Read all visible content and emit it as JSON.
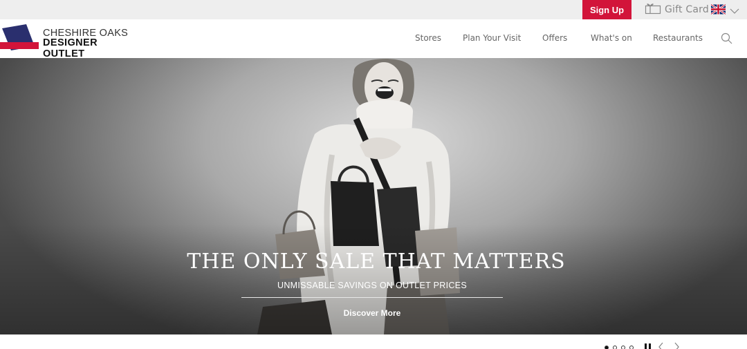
{
  "utility": {
    "signup_label": "Sign Up",
    "giftcard_label": "Gift Card",
    "signup_color": "#d2143a"
  },
  "header": {
    "logo_line1": "CHESHIRE OAKS",
    "logo_line2": "DESIGNER OUTLET",
    "nav": [
      "Stores",
      "Plan Your Visit",
      "Offers",
      "What's on",
      "Restaurants"
    ]
  },
  "hero": {
    "headline": "THE ONLY SALE THAT MATTERS",
    "subheadline": "UNMISSABLE SAVINGS ON OUTLET PRICES",
    "cta_label": "Discover More"
  },
  "carousel": {
    "slide_count": 4,
    "active_index": 0
  },
  "icons": {
    "gift": "gift-icon",
    "flag": "uk-flag-icon",
    "chevron": "chevron-down-icon",
    "search": "search-icon",
    "pause": "pause-icon",
    "prev": "chevron-left-icon",
    "next": "chevron-right-icon"
  }
}
